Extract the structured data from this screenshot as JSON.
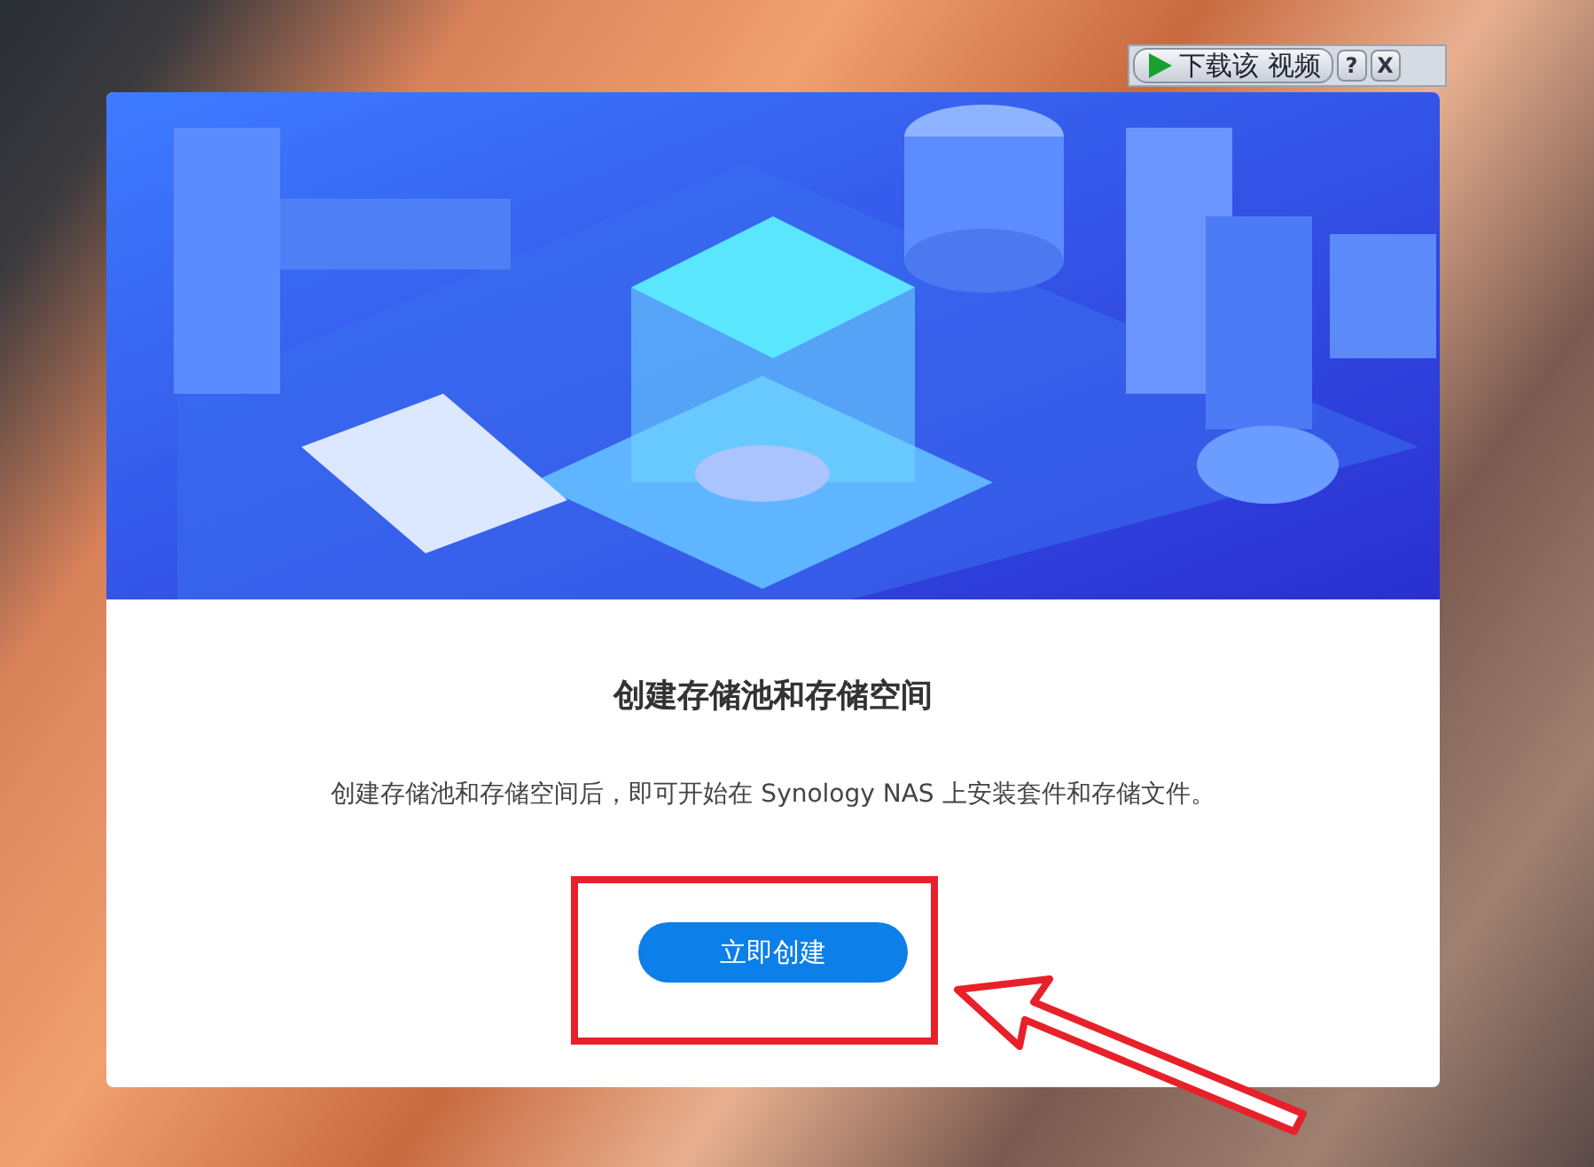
{
  "video_toolbar": {
    "download_label": "下载该 视频",
    "help": "?",
    "close": "X"
  },
  "dialog": {
    "title": "创建存储池和存储空间",
    "description": "创建存储池和存储空间后，即可开始在 Synology NAS 上安装套件和存储文件。",
    "button": "立即创建"
  }
}
